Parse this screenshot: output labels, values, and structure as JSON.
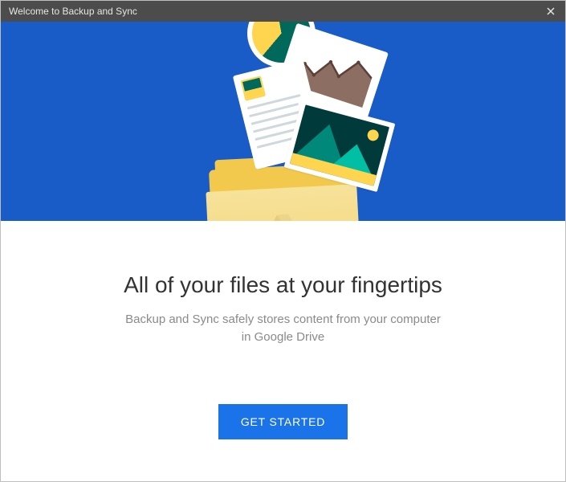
{
  "window": {
    "title": "Welcome to Backup and Sync"
  },
  "main": {
    "headline": "All of your files at your fingertips",
    "subhead_line1": "Backup and Sync safely stores content from your computer",
    "subhead_line2": "in Google Drive",
    "cta_label": "GET STARTED"
  },
  "colors": {
    "hero_bg": "#195bc7",
    "cta_bg": "#1a73e8"
  }
}
